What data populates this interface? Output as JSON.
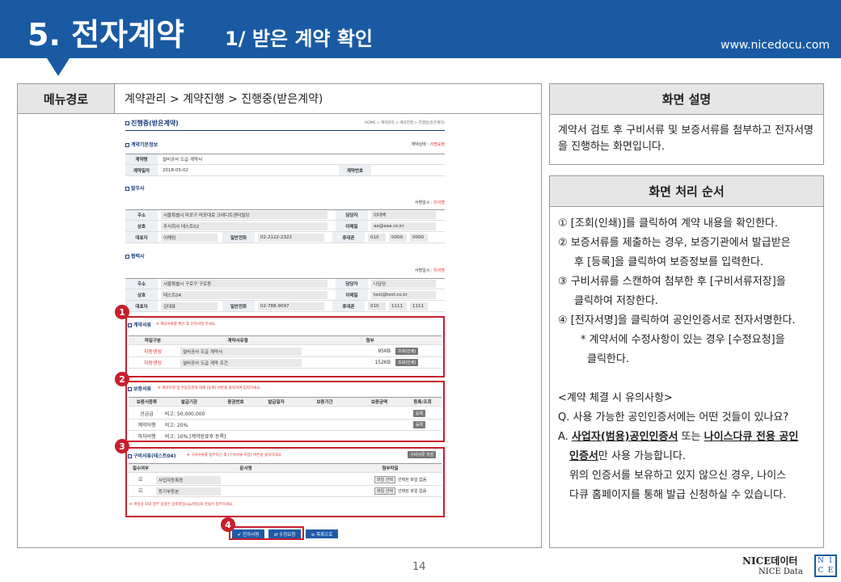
{
  "header": {
    "title": "5. 전자계약",
    "subtitle": "1/ 받은 계약 확인",
    "url": "www.nicedocu.com"
  },
  "menu": {
    "label": "메뉴경로",
    "path": "계약관리 > 계약진행 > 진행중(받은계약)"
  },
  "panel_desc": {
    "title": "화면 설명",
    "text": "계약서 검토 후 구비서류 및 보증서류를 첨부하고 전자서명을 진행하는 화면입니다."
  },
  "panel_steps": {
    "title": "화면 처리 순서",
    "s1": "① [조회(인쇄)]를 클릭하여 계약 내용을 확인한다.",
    "s2a": "② 보증서류를 제출하는 경우, 보증기관에서 발급받은",
    "s2b": "후 [등록]을 클릭하여 보증정보를 입력한다.",
    "s3a": "③ 구비서류를 스캔하여 첨부한 후 [구비서류저장]을",
    "s3b": "클릭하여 저장한다.",
    "s4": "④ [전자서명]을 클릭하여 공인인증서로 전자서명한다.",
    "s5a": "* 계약서에 수정사항이 있는 경우 [수정요청]을",
    "s5b": "클릭한다.",
    "note_title": "<계약 체결 시 유의사항>",
    "q": "Q. 사용 가능한 공인인증서에는 어떤 것들이 있나요?",
    "a_pre": "A. ",
    "a_u1": "사업자(범용)공인인증서",
    "a_mid": " 또는 ",
    "a_u2a": "나이스다큐 전용 공인",
    "a_u2b": "인증서",
    "a_post": "만 사용 가능합니다.",
    "a2": "위의 인증서를 보유하고 있지 않으신 경우, 나이스",
    "a3": "다큐 홈페이지를 통해 발급 신청하실 수 있습니다."
  },
  "mock": {
    "title": "진행중(받은계약)",
    "crumb": "HOME > 계약관리 > 계약진행 > 진행중(받은계약)",
    "basic": "계약기본정보",
    "status_label": "계약상태 : ",
    "status_val": "서명요청",
    "name_lbl": "계약명",
    "name_val": "설비공사 도급 계약서",
    "date_lbl": "계약일자",
    "date_val": "2018-05-02",
    "no_lbl": "계약번호",
    "owner": "발주사",
    "sign_lbl": "서명일시 : ",
    "sign_val": "미서명",
    "addr_lbl": "주소",
    "addr1": "서울특별시 마포구 마포대로 크레디트센터빌딩",
    "mgr_lbl": "담당자",
    "mgr1": "이대백",
    "co_lbl": "상호",
    "co1": "주식회사 테스트02",
    "mail_lbl": "이메일",
    "mail1": "aa@aaa.co.kr",
    "ceo_lbl": "대표자",
    "ceo1": "이해림",
    "tel_lbl": "일반전화",
    "tel1": "02-2122-2322",
    "mob_lbl": "휴대폰",
    "mob1": [
      "010",
      "0000",
      "0000"
    ],
    "contractor": "협력사",
    "addr2": "서울특별시 구로구 구로동",
    "mgr2": "나담당",
    "co2": "테스트04",
    "mail2": "test@test.co.kr",
    "ceo2": "김대표",
    "tel2": "02-788-9097",
    "mob2": [
      "010",
      "1111",
      "1111"
    ],
    "docs": "계약서류",
    "docs_note": "※ 계약서류를 확인 후 전자서명 하세요.",
    "docs_h": [
      "파일구분",
      "계약서유형",
      "첨부"
    ],
    "docs_rows": [
      {
        "type": "자동생성",
        "name": "설비공사 도급 계약서",
        "size": "95KB",
        "btn": "조회(인쇄)"
      },
      {
        "type": "자동생성",
        "name": "설비공사 도급 계약 조건",
        "size": "152KB",
        "btn": "조회(인쇄)"
      }
    ],
    "guar": "보증서류",
    "guar_note": "※ 계약이행 및 부동증권에 대해 [등록] 버튼을 클릭하여 입력하세요.",
    "guar_h": [
      "보증서종류",
      "발급기관",
      "증권번호",
      "발급일자",
      "보증기간",
      "보증금액",
      "등록/조회"
    ],
    "guar_rows": [
      {
        "kind": "선금급",
        "memo": "비고: 50,000,000",
        "btn": "등록"
      },
      {
        "kind": "계약이행",
        "memo": "비고: 20%",
        "btn": "등록"
      },
      {
        "kind": "하자이행",
        "memo": "비고: 10% [계약완료후 등록]",
        "btn": ""
      }
    ],
    "req": "구비서류(테스트04)",
    "req_note": "※ 구비서류를 첨부하신 후 [구비서류 저장] 버튼을 클릭하세요.",
    "req_save": "구비서류 저장",
    "req_h": [
      "필수여부",
      "문서명",
      "첨부파일"
    ],
    "req_rows": [
      {
        "name": "사업자등록증",
        "file_btn": "파일 선택",
        "file_txt": "선택된 파일 없음"
      },
      {
        "name": "등기부등본",
        "file_btn": "파일 선택",
        "file_txt": "선택된 파일 없음"
      }
    ],
    "req_foot": "※ 파일의 최대 첨부 용량은 압축파일(zip파일)로 만들어 첨부하세요.",
    "btn_sign": "✔ 전자서명",
    "btn_edit": "⇄ 수정요청",
    "btn_list": "≡ 목록으로"
  },
  "badges": [
    "1",
    "2",
    "3",
    "4"
  ],
  "page_no": "14",
  "logo": {
    "line1": "NICE데이터",
    "line2": "NICE Data",
    "box": [
      "N",
      "I",
      "C",
      "E"
    ]
  },
  "colors": {
    "brand": "#1a5aa3",
    "highlight": "#c81e2c"
  }
}
